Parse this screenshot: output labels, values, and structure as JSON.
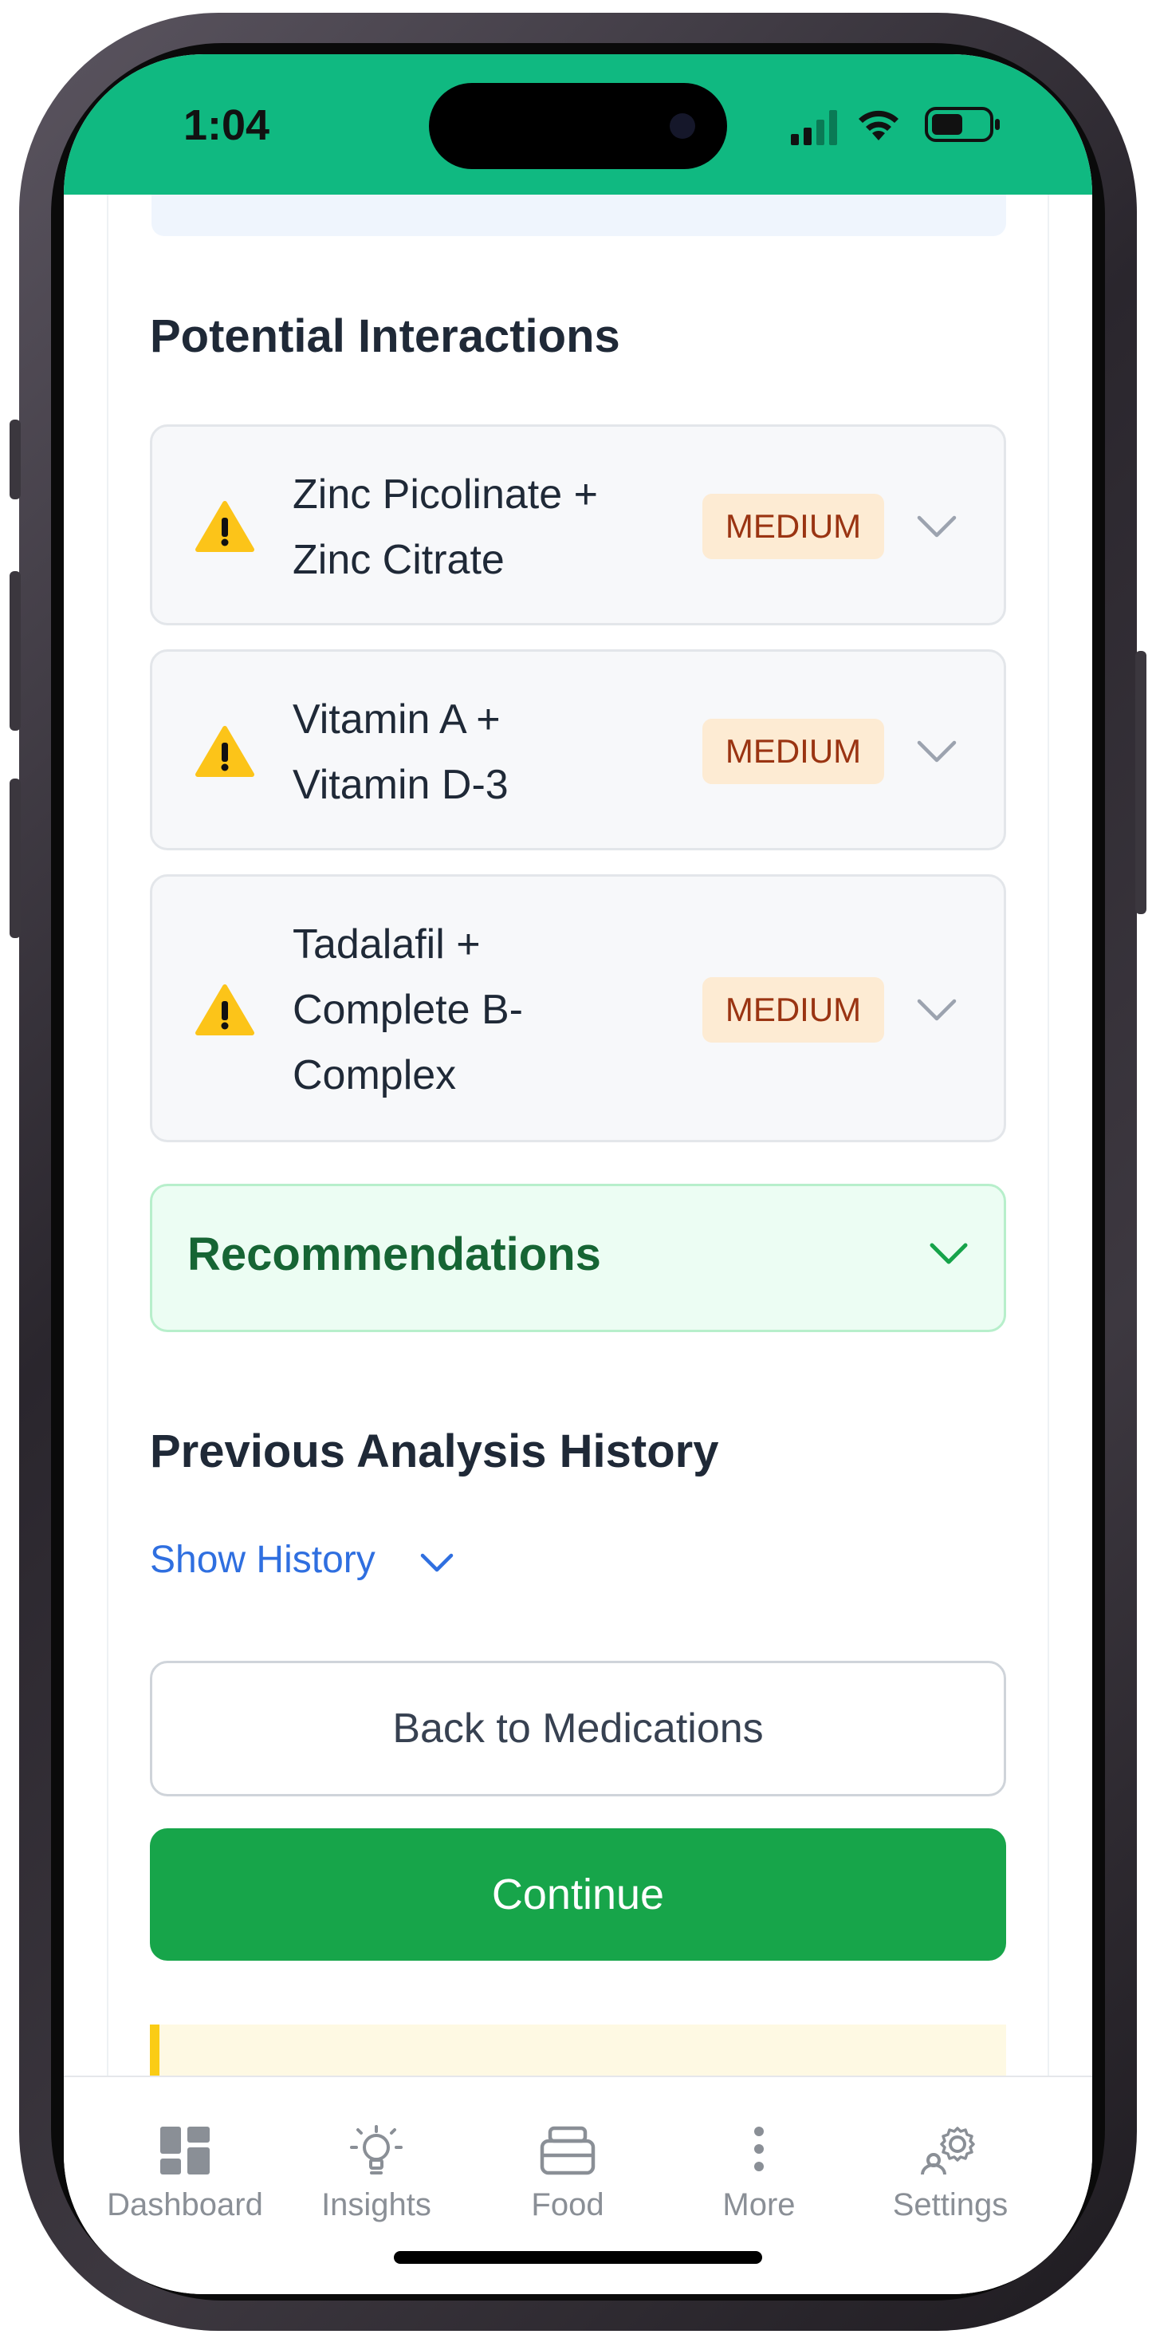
{
  "status": {
    "time": "1:04"
  },
  "interactions": {
    "title": "Potential Interactions",
    "items": [
      {
        "lines": [
          "Zinc Picolinate +",
          "Zinc Citrate"
        ],
        "severity": "MEDIUM"
      },
      {
        "lines": [
          "Vitamin A +",
          "Vitamin D-3"
        ],
        "severity": "MEDIUM"
      },
      {
        "lines": [
          "Tadalafil +",
          "Complete B-",
          "Complex"
        ],
        "severity": "MEDIUM"
      }
    ]
  },
  "recommendations": {
    "label": "Recommendations"
  },
  "history": {
    "title": "Previous Analysis History",
    "toggle_label": "Show History"
  },
  "actions": {
    "back_label": "Back to Medications",
    "continue_label": "Continue"
  },
  "tabbar": {
    "items": [
      {
        "label": "Dashboard",
        "icon": "dashboard-icon"
      },
      {
        "label": "Insights",
        "icon": "lightbulb-icon"
      },
      {
        "label": "Food",
        "icon": "food-container-icon"
      },
      {
        "label": "More",
        "icon": "vertical-dots-icon"
      },
      {
        "label": "Settings",
        "icon": "gear-person-icon"
      }
    ]
  },
  "colors": {
    "header_green": "#10b981",
    "continue_green": "#17a54a",
    "medium_badge_bg": "#fdebd3",
    "medium_badge_text": "#9a3412",
    "link_blue": "#2f6fe0"
  }
}
